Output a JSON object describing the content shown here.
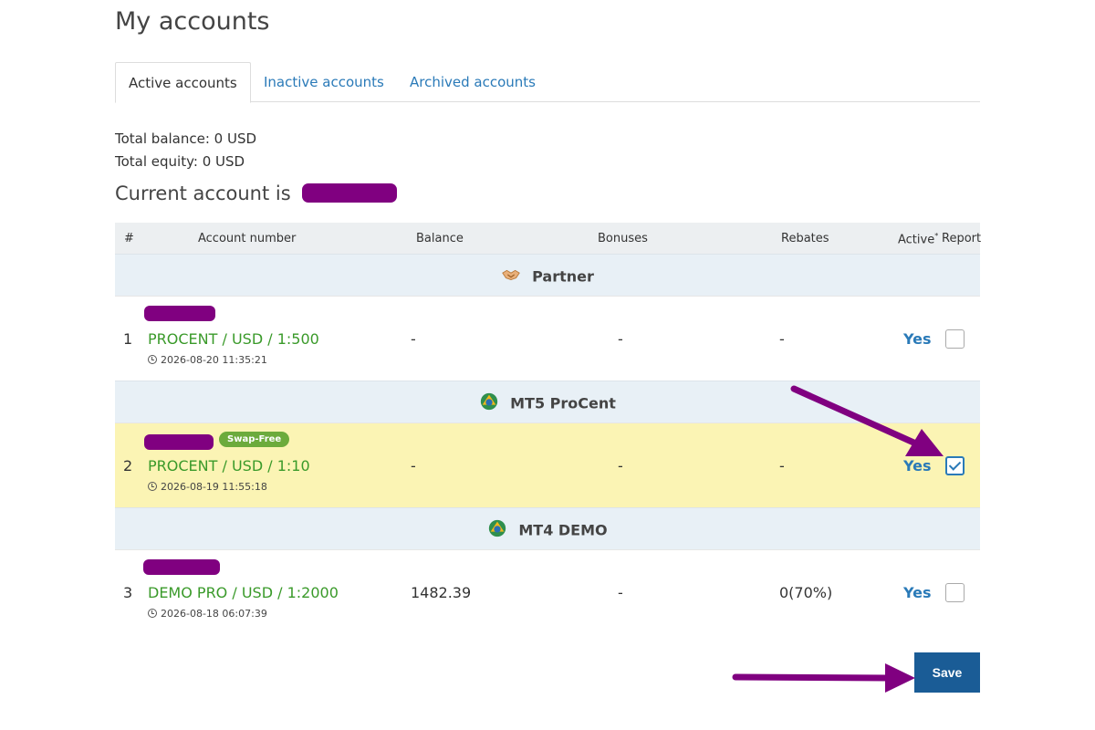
{
  "page": {
    "title": "My accounts"
  },
  "tabs": [
    {
      "label": "Active accounts",
      "active": true
    },
    {
      "label": "Inactive accounts",
      "active": false
    },
    {
      "label": "Archived accounts",
      "active": false
    }
  ],
  "summary": {
    "total_balance": "Total balance: 0 USD",
    "total_equity": "Total equity: 0 USD",
    "current_account_label": "Current account is"
  },
  "table": {
    "headers": {
      "num": "#",
      "account": "Account number",
      "balance": "Balance",
      "bonuses": "Bonuses",
      "rebates": "Rebates",
      "active": "Active",
      "active_sup": "*",
      "report": "Report"
    },
    "groups": [
      {
        "name": "Partner",
        "icon": "handshake-icon",
        "rows": [
          {
            "num": "1",
            "type": "PROCENT / USD / 1:500",
            "date": "2026-08-20 11:35:21",
            "balance": "-",
            "bonuses": "-",
            "rebates": "-",
            "active": "Yes",
            "report_checked": false,
            "tag": ""
          }
        ]
      },
      {
        "name": "MT5 ProCent",
        "icon": "metatrader-icon",
        "rows": [
          {
            "num": "2",
            "type": "PROCENT / USD / 1:10",
            "date": "2026-08-19 11:55:18",
            "balance": "-",
            "bonuses": "-",
            "rebates": "-",
            "active": "Yes",
            "report_checked": true,
            "tag": "Swap-Free"
          }
        ]
      },
      {
        "name": "MT4 DEMO",
        "icon": "metatrader-icon",
        "rows": [
          {
            "num": "3",
            "type": "DEMO PRO / USD / 1:2000",
            "date": "2026-08-18 06:07:39",
            "balance": "1482.39",
            "bonuses": "-",
            "rebates": "0(70%)",
            "active": "Yes",
            "report_checked": false,
            "tag": ""
          }
        ]
      }
    ]
  },
  "actions": {
    "save_label": "Save"
  },
  "colors": {
    "accent_blue": "#2a7ab8",
    "account_green": "#3a9a2a",
    "highlight_row": "#fbf4b4",
    "redaction": "#800080",
    "save_button": "#1a5c96",
    "swap_free_tag": "#6cab3c"
  }
}
